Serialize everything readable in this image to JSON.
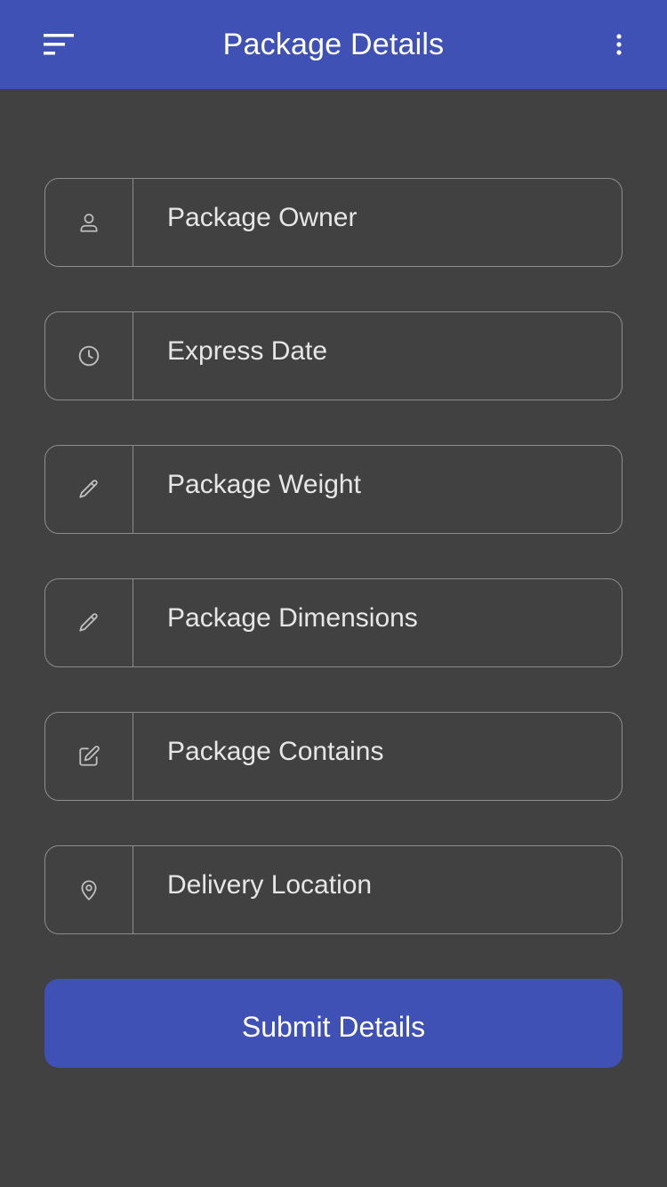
{
  "header": {
    "title": "Package Details",
    "menu_icon": "sort-menu-icon",
    "more_icon": "more-vertical-icon"
  },
  "form": {
    "fields": [
      {
        "placeholder": "Package Owner",
        "icon": "user-icon"
      },
      {
        "placeholder": " Express Date",
        "icon": "clock-icon"
      },
      {
        "placeholder": "Package Weight",
        "icon": "pencil-icon"
      },
      {
        "placeholder": "Package Dimensions",
        "icon": "pencil-icon"
      },
      {
        "placeholder": "Package Contains",
        "icon": "edit-square-icon"
      },
      {
        "placeholder": "Delivery Location",
        "icon": "map-pin-icon"
      }
    ],
    "submit_label": "Submit Details"
  },
  "colors": {
    "primary": "#3f51b5",
    "background": "#414141",
    "border": "#8d8d8d",
    "text": "#e6e6e6"
  }
}
